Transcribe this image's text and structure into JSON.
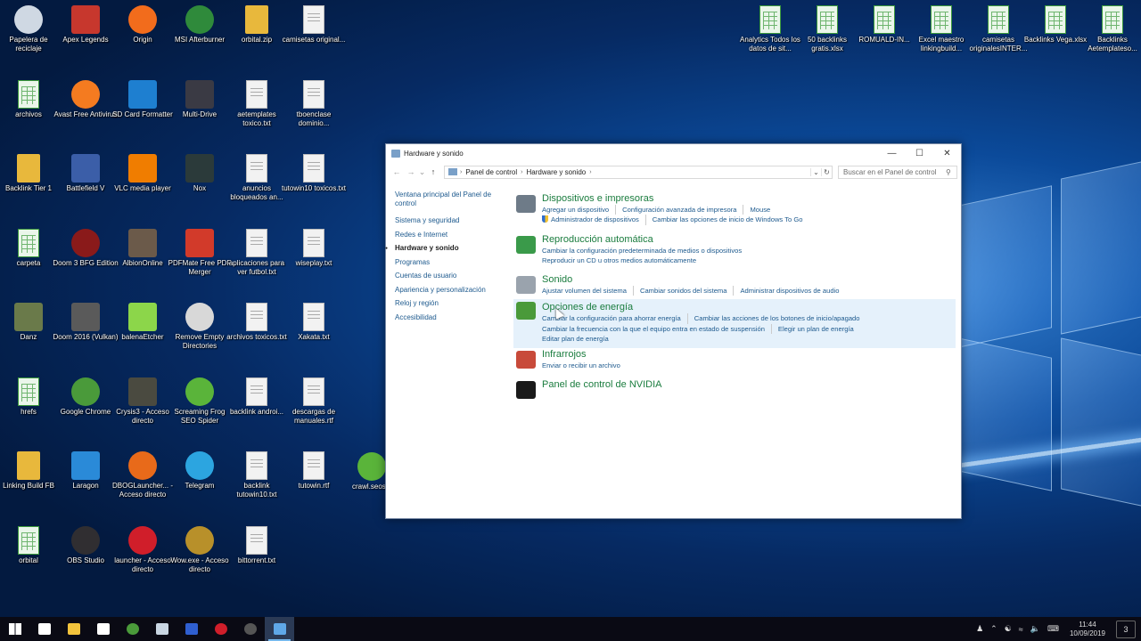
{
  "colors": {
    "accent_green": "#1a7c3e",
    "link_blue": "#1e5a8e",
    "taskbar": "#0a0a14"
  },
  "desktop": {
    "left_icons": [
      {
        "label": "Papelera de reciclaje",
        "icon": "recycle-bin-icon",
        "kind": "round",
        "color": "#cfd8e3"
      },
      {
        "label": "Apex Legends",
        "icon": "apex-legends-icon",
        "kind": "",
        "color": "#c7372d"
      },
      {
        "label": "Origin",
        "icon": "origin-icon",
        "kind": "round",
        "color": "#f26c1c"
      },
      {
        "label": "MSI Afterburner",
        "icon": "msi-afterburner-icon",
        "kind": "round",
        "color": "#2f8a3b"
      },
      {
        "label": "orbital.zip",
        "icon": "zip-folder-icon",
        "kind": "folder",
        "color": "#e8b83c"
      },
      {
        "label": "camisetas original...",
        "icon": "text-file-icon",
        "kind": "doc",
        "color": "#f2f2f2"
      },
      {
        "label": "archivos",
        "icon": "spreadsheet-icon",
        "kind": "xls",
        "color": "#eaf6ea"
      },
      {
        "label": "Avast Free Antivirus",
        "icon": "avast-icon",
        "kind": "round",
        "color": "#f47b20"
      },
      {
        "label": "SD Card Formatter",
        "icon": "sd-card-icon",
        "kind": "",
        "color": "#1e7fd0"
      },
      {
        "label": "Multi-Drive",
        "icon": "nox-multidrive-icon",
        "kind": "",
        "color": "#3a3a44"
      },
      {
        "label": "aetemplates toxico.txt",
        "icon": "text-file-icon",
        "kind": "doc",
        "color": "#f2f2f2"
      },
      {
        "label": "tboenclase dominio...",
        "icon": "text-file-icon",
        "kind": "doc",
        "color": "#f2f2f2"
      },
      {
        "label": "Backlink Tier 1",
        "icon": "folder-icon",
        "kind": "folder",
        "color": "#e8b83c"
      },
      {
        "label": "Battlefield V",
        "icon": "battlefield-icon",
        "kind": "",
        "color": "#3b5ea8"
      },
      {
        "label": "VLC media player",
        "icon": "vlc-icon",
        "kind": "",
        "color": "#f07d00"
      },
      {
        "label": "Nox",
        "icon": "nox-icon",
        "kind": "",
        "color": "#2b3a3a"
      },
      {
        "label": "anuncios bloqueados an...",
        "icon": "text-file-icon",
        "kind": "doc",
        "color": "#f2f2f2"
      },
      {
        "label": "tutowin10 toxicos.txt",
        "icon": "text-file-icon",
        "kind": "doc",
        "color": "#f2f2f2"
      },
      {
        "label": "carpeta",
        "icon": "spreadsheet-icon",
        "kind": "xls",
        "color": "#eaf6ea"
      },
      {
        "label": "Doom 3 BFG Edition",
        "icon": "doom3-icon",
        "kind": "round",
        "color": "#8a1a1a"
      },
      {
        "label": "AlbionOnline",
        "icon": "albion-icon",
        "kind": "",
        "color": "#6b5a4a"
      },
      {
        "label": "PDFMate Free PDF Merger",
        "icon": "pdf-merger-icon",
        "kind": "",
        "color": "#d23a2a"
      },
      {
        "label": "aplicaciones para ver futbol.txt",
        "icon": "text-file-icon",
        "kind": "doc",
        "color": "#f2f2f2"
      },
      {
        "label": "wiseplay.txt",
        "icon": "text-file-icon",
        "kind": "doc",
        "color": "#f2f2f2"
      },
      {
        "label": "Danz",
        "icon": "archive-icon",
        "kind": "",
        "color": "#6a7a4a"
      },
      {
        "label": "Doom 2016 (Vulkan)",
        "icon": "doom-icon",
        "kind": "",
        "color": "#5a5a5a"
      },
      {
        "label": "balenaEtcher",
        "icon": "balena-etcher-icon",
        "kind": "",
        "color": "#8cd64a"
      },
      {
        "label": "Remove Empty Directories",
        "icon": "remove-dirs-icon",
        "kind": "round",
        "color": "#d8d8d8"
      },
      {
        "label": "archivos toxicos.txt",
        "icon": "text-file-icon",
        "kind": "doc",
        "color": "#f2f2f2"
      },
      {
        "label": "Xakata.txt",
        "icon": "text-file-icon",
        "kind": "doc",
        "color": "#f2f2f2"
      },
      {
        "label": "hrefs",
        "icon": "spreadsheet-icon",
        "kind": "xls",
        "color": "#eaf6ea"
      },
      {
        "label": "Google Chrome",
        "icon": "chrome-icon",
        "kind": "round",
        "color": "#4a9a3a"
      },
      {
        "label": "Crysis3 - Acceso directo",
        "icon": "crysis3-icon",
        "kind": "",
        "color": "#4a4a40"
      },
      {
        "label": "Screaming Frog SEO Spider",
        "icon": "screaming-frog-icon",
        "kind": "round",
        "color": "#5ab43a"
      },
      {
        "label": "backlink androi...",
        "icon": "text-file-icon",
        "kind": "doc",
        "color": "#f2f2f2"
      },
      {
        "label": "descargas de manuales.rtf",
        "icon": "rtf-file-icon",
        "kind": "doc",
        "color": "#e8f0fa"
      },
      {
        "label": "Linking Build FB",
        "icon": "folder-icon",
        "kind": "folder",
        "color": "#e8b83c"
      },
      {
        "label": "Laragon",
        "icon": "laragon-icon",
        "kind": "",
        "color": "#2a8ad8"
      },
      {
        "label": "DBOGLauncher... - Acceso directo",
        "icon": "dbog-launcher-icon",
        "kind": "round",
        "color": "#e86a1a"
      },
      {
        "label": "Telegram",
        "icon": "telegram-icon",
        "kind": "round",
        "color": "#2ca5e0"
      },
      {
        "label": "backlink tutowin10.txt",
        "icon": "text-file-icon",
        "kind": "doc",
        "color": "#f2f2f2"
      },
      {
        "label": "tutowin.rtf",
        "icon": "rtf-file-icon",
        "kind": "doc",
        "color": "#e8f0fa"
      },
      {
        "label": "orbital",
        "icon": "spreadsheet-icon",
        "kind": "xls",
        "color": "#eaf6ea"
      },
      {
        "label": "OBS Studio",
        "icon": "obs-icon",
        "kind": "round",
        "color": "#302e31"
      },
      {
        "label": "launcher - Acceso directo",
        "icon": "opera-icon",
        "kind": "round",
        "color": "#d01e2a"
      },
      {
        "label": "Wow.exe - Acceso directo",
        "icon": "wow-icon",
        "kind": "round",
        "color": "#b8902a"
      },
      {
        "label": "bittorrent.txt",
        "icon": "text-file-icon",
        "kind": "doc",
        "color": "#f2f2f2"
      },
      {
        "label": "",
        "icon": "",
        "kind": "",
        "color": ""
      }
    ],
    "extra_icon": {
      "label": "crawl.seospi",
      "icon": "screaming-frog-icon",
      "color": "#5ab43a"
    },
    "right_icons": [
      {
        "label": "Analytics Todos los datos de sit...",
        "icon": "spreadsheet-icon"
      },
      {
        "label": "50 backlinks gratis.xlsx",
        "icon": "spreadsheet-icon"
      },
      {
        "label": "ROMUALD-IN...",
        "icon": "spreadsheet-icon"
      },
      {
        "label": "Excel maestro linkingbuild...",
        "icon": "spreadsheet-icon"
      },
      {
        "label": "camisetas originalesINTER...",
        "icon": "spreadsheet-icon"
      },
      {
        "label": "Backlinks Vega.xlsx",
        "icon": "spreadsheet-icon"
      },
      {
        "label": "Backlinks Aetemplateso...",
        "icon": "spreadsheet-icon"
      }
    ]
  },
  "window": {
    "title": "Hardware y sonido",
    "breadcrumb": [
      "Panel de control",
      "Hardware y sonido"
    ],
    "search_placeholder": "Buscar en el Panel de control",
    "left_nav": [
      {
        "label": "Ventana principal del Panel de control",
        "current": false
      },
      {
        "label": "Sistema y seguridad",
        "current": false
      },
      {
        "label": "Redes e Internet",
        "current": false
      },
      {
        "label": "Hardware y sonido",
        "current": true
      },
      {
        "label": "Programas",
        "current": false
      },
      {
        "label": "Cuentas de usuario",
        "current": false
      },
      {
        "label": "Apariencia y personalización",
        "current": false
      },
      {
        "label": "Reloj y región",
        "current": false
      },
      {
        "label": "Accesibilidad",
        "current": false
      }
    ],
    "categories": [
      {
        "title": "Dispositivos e impresoras",
        "icon": "printer-icon",
        "hover": false,
        "links": [
          {
            "label": "Agregar un dispositivo"
          },
          {
            "label": "Configuración avanzada de impresora"
          },
          {
            "label": "Mouse",
            "end": true
          },
          {
            "label": "Administrador de dispositivos",
            "shield": true
          },
          {
            "label": "Cambiar las opciones de inicio de Windows To Go",
            "end": true
          }
        ]
      },
      {
        "title": "Reproducción automática",
        "icon": "autoplay-icon",
        "hover": false,
        "links": [
          {
            "label": "Cambiar la configuración predeterminada de medios o dispositivos",
            "end": true
          },
          {
            "label": "Reproducir un CD u otros medios automáticamente",
            "end": true
          }
        ]
      },
      {
        "title": "Sonido",
        "icon": "speaker-icon",
        "hover": false,
        "links": [
          {
            "label": "Ajustar volumen del sistema"
          },
          {
            "label": "Cambiar sonidos del sistema"
          },
          {
            "label": "Administrar dispositivos de audio",
            "end": true
          }
        ]
      },
      {
        "title": "Opciones de energía",
        "icon": "power-options-icon",
        "hover": true,
        "links": [
          {
            "label": "Cambiar la configuración para ahorrar energía"
          },
          {
            "label": "Cambiar las acciones de los botones de inicio/apagado",
            "end": true
          },
          {
            "label": "Cambiar la frecuencia con la que el equipo entra en estado de suspensión"
          },
          {
            "label": "Elegir un plan de energía",
            "end": true
          },
          {
            "label": "Editar plan de energía",
            "end": true
          }
        ]
      },
      {
        "title": "Infrarrojos",
        "icon": "infrared-icon",
        "hover": false,
        "links": [
          {
            "label": "Enviar o recibir un archivo",
            "end": true
          }
        ]
      },
      {
        "title": "Panel de control de NVIDIA",
        "icon": "nvidia-icon",
        "hover": false,
        "links": []
      }
    ]
  },
  "taskbar": {
    "items": [
      {
        "name": "start-button",
        "icon": "windows-start-icon",
        "color": "#ffffff",
        "active": false
      },
      {
        "name": "task-view-button",
        "icon": "task-view-icon",
        "color": "#ffffff",
        "active": false
      },
      {
        "name": "file-explorer-button",
        "icon": "file-explorer-icon",
        "color": "#f3c33c",
        "active": false
      },
      {
        "name": "store-button",
        "icon": "store-icon",
        "color": "#ffffff",
        "active": false
      },
      {
        "name": "chrome-button",
        "icon": "chrome-icon",
        "color": "#4a9a3a",
        "active": false
      },
      {
        "name": "app-button",
        "icon": "app-icon",
        "color": "#c9d6e3",
        "active": false
      },
      {
        "name": "remote-desktop-button",
        "icon": "monitor-icon",
        "color": "#2f5fd0",
        "active": false
      },
      {
        "name": "opera-button",
        "icon": "opera-icon",
        "color": "#d01e2a",
        "active": false
      },
      {
        "name": "obs-button",
        "icon": "obs-icon",
        "color": "#555555",
        "active": false
      },
      {
        "name": "control-panel-button",
        "icon": "control-panel-icon",
        "color": "#5fa8e8",
        "active": true
      }
    ],
    "time": "11:44",
    "date": "10/09/2019",
    "notification_count": "3"
  }
}
